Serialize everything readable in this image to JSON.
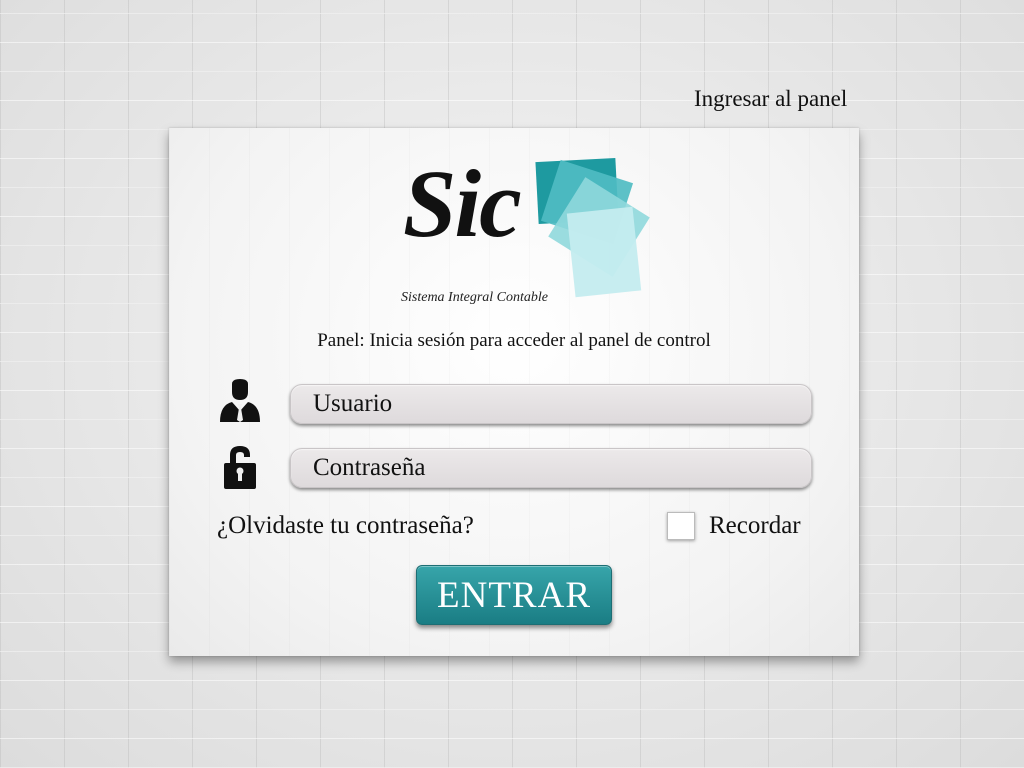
{
  "header": {
    "link_label": "Ingresar al panel"
  },
  "logo": {
    "brand": "Sic",
    "tagline": "Sistema Integral Contable",
    "colors": [
      "#1e9aa0",
      "#4fbcc2",
      "#8fd8dc",
      "#c4ecef"
    ]
  },
  "panel": {
    "subtitle": "Panel: Inicia sesión para acceder al panel de control"
  },
  "form": {
    "username": {
      "placeholder": "Usuario",
      "value": "",
      "icon": "user-icon"
    },
    "password": {
      "placeholder": "Contraseña",
      "value": "",
      "icon": "lock-icon"
    },
    "forgot_label": "¿Olvidaste tu contraseña?",
    "remember": {
      "label": "Recordar",
      "checked": false
    },
    "submit_label": "ENTRAR"
  },
  "colors": {
    "accent": "#26949a",
    "field_bg": "#e4e1e2"
  }
}
